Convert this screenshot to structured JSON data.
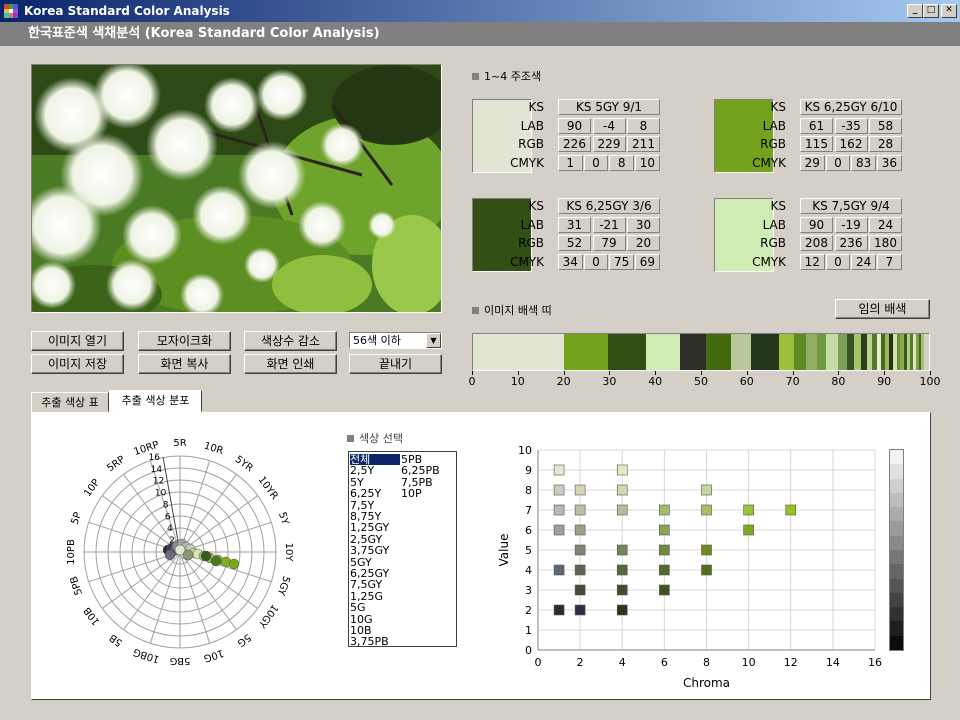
{
  "window": {
    "title": "Korea Standard Color Analysis",
    "subtitle": "한국표준색 색채분석 (Korea Standard Color Analysis)"
  },
  "buttons": {
    "open": "이미지 열기",
    "mosaic": "모자이크화",
    "reduce": "색상수 감소",
    "save": "이미지 저장",
    "copy": "화면 복사",
    "print": "화면 인쇄",
    "exit": "끝내기",
    "random": "임의 배색"
  },
  "dropdown": {
    "value": "56색 이하"
  },
  "main_colors": {
    "heading": "1~4 주조색",
    "labels": [
      "KS",
      "LAB",
      "RGB",
      "CMYK"
    ],
    "items": [
      {
        "ks": "KS 5GY 9/1",
        "lab": [
          "90",
          "-4",
          "8"
        ],
        "rgb": [
          "226",
          "229",
          "211"
        ],
        "cmyk": [
          "1",
          "0",
          "8",
          "10"
        ],
        "color": "#e2e5d3"
      },
      {
        "ks": "KS 6,25GY 6/10",
        "lab": [
          "61",
          "-35",
          "58"
        ],
        "rgb": [
          "115",
          "162",
          "28"
        ],
        "cmyk": [
          "29",
          "0",
          "83",
          "36"
        ],
        "color": "#73a21c"
      },
      {
        "ks": "KS 6,25GY 3/6",
        "lab": [
          "31",
          "-21",
          "30"
        ],
        "rgb": [
          "52",
          "79",
          "20"
        ],
        "cmyk": [
          "34",
          "0",
          "75",
          "69"
        ],
        "color": "#344f14"
      },
      {
        "ks": "KS 7,5GY 9/4",
        "lab": [
          "90",
          "-19",
          "24"
        ],
        "rgb": [
          "208",
          "236",
          "180"
        ],
        "cmyk": [
          "12",
          "0",
          "24",
          "7"
        ],
        "color": "#d0ecb4"
      }
    ]
  },
  "palette": {
    "heading": "이미지 배색 띠",
    "ticks": [
      "0",
      "10",
      "20",
      "30",
      "40",
      "50",
      "60",
      "70",
      "80",
      "90",
      "100"
    ],
    "segments": [
      {
        "color": "#e2e5d3",
        "w": 20
      },
      {
        "color": "#73a21c",
        "w": 9.5
      },
      {
        "color": "#344f14",
        "w": 8.5
      },
      {
        "color": "#d0ecb4",
        "w": 7.5
      },
      {
        "color": "#2d2f26",
        "w": 5.5
      },
      {
        "color": "#436a0e",
        "w": 5.5
      },
      {
        "color": "#b8c89c",
        "w": 4.5
      },
      {
        "color": "#22371c",
        "w": 6
      },
      {
        "color": "#9cc03a",
        "w": 3.5
      },
      {
        "color": "#5e8a25",
        "w": 2.5
      },
      {
        "color": "#8fae68",
        "w": 2.5
      },
      {
        "color": "#6e9a46",
        "w": 2
      },
      {
        "color": "#c6dca4",
        "w": 2.5
      },
      {
        "color": "#7f9e5a",
        "w": 2
      },
      {
        "color": "#3a5224",
        "w": 1.5
      },
      {
        "color": "#a5c46e",
        "w": 1.5
      },
      {
        "color": "#2e3e1c",
        "w": 1.3
      },
      {
        "color": "#bcd68e",
        "w": 1.2
      },
      {
        "color": "#557c2e",
        "w": 1
      },
      {
        "color": "#e8f0d0",
        "w": 1
      },
      {
        "color": "#4a6a20",
        "w": 0.9
      },
      {
        "color": "#9ab860",
        "w": 0.9
      },
      {
        "color": "#263218",
        "w": 0.8
      },
      {
        "color": "#cfe0a8",
        "w": 0.8
      },
      {
        "color": "#6c8c3c",
        "w": 0.8
      },
      {
        "color": "#88aa4c",
        "w": 0.8
      },
      {
        "color": "#3c5a1a",
        "w": 0.7
      },
      {
        "color": "#b4cc84",
        "w": 0.7
      },
      {
        "color": "#5a7830",
        "w": 0.7
      },
      {
        "color": "#dce8c0",
        "w": 0.6
      },
      {
        "color": "#7aa03a",
        "w": 0.6
      },
      {
        "color": "#486428",
        "w": 0.5
      },
      {
        "color": "#a8c078",
        "w": 0.5
      }
    ]
  },
  "tabs": [
    "추출 색상 표",
    "추출 색상 분포"
  ],
  "hue_select": {
    "heading": "색상 선택",
    "items": [
      "전체",
      "2,5Y",
      "5Y",
      "6,25Y",
      "7,5Y",
      "8,75Y",
      "1,25GY",
      "2,5GY",
      "3,75GY",
      "5GY",
      "6,25GY",
      "7,5GY",
      "1,25G",
      "5G",
      "10G",
      "10B",
      "3,75PB",
      "5PB",
      "6,25PB",
      "7,5PB",
      "10P"
    ]
  },
  "polar_chart": {
    "hue_labels": [
      "5R",
      "10R",
      "5YR",
      "10YR",
      "5Y",
      "10Y",
      "5GY",
      "10GY",
      "5G",
      "10G",
      "5BG",
      "10BG",
      "5B",
      "10B",
      "5PB",
      "10PB",
      "5P",
      "10P",
      "5RP",
      "10RP"
    ],
    "rings": [
      "2",
      "4",
      "6",
      "8",
      "10",
      "12",
      "14",
      "16"
    ]
  },
  "chart_data": {
    "type": "scatter",
    "xlabel": "Chroma",
    "ylabel": "Value",
    "xlim": [
      0,
      16
    ],
    "ylim": [
      0,
      10
    ],
    "xticks": [
      "0",
      "2",
      "4",
      "6",
      "8",
      "10",
      "12",
      "14",
      "16"
    ],
    "yticks": [
      "0",
      "1",
      "2",
      "3",
      "4",
      "5",
      "6",
      "7",
      "8",
      "9",
      "10"
    ],
    "points": [
      {
        "x": 1,
        "y": 9,
        "c": "#e6e8d6"
      },
      {
        "x": 4,
        "y": 9,
        "c": "#e0ecc8"
      },
      {
        "x": 1,
        "y": 8,
        "c": "#c8cfc0"
      },
      {
        "x": 2,
        "y": 8,
        "c": "#d8d4b8"
      },
      {
        "x": 4,
        "y": 8,
        "c": "#cdd8b4"
      },
      {
        "x": 8,
        "y": 8,
        "c": "#c2d896"
      },
      {
        "x": 1,
        "y": 7,
        "c": "#b4bcae"
      },
      {
        "x": 2,
        "y": 7,
        "c": "#b8c0a6"
      },
      {
        "x": 4,
        "y": 7,
        "c": "#b0bf98"
      },
      {
        "x": 6,
        "y": 7,
        "c": "#a2bb70"
      },
      {
        "x": 8,
        "y": 7,
        "c": "#a6c260"
      },
      {
        "x": 10,
        "y": 7,
        "c": "#9cc23a"
      },
      {
        "x": 12,
        "y": 7,
        "c": "#96c220"
      },
      {
        "x": 1,
        "y": 6,
        "c": "#9aa496"
      },
      {
        "x": 2,
        "y": 6,
        "c": "#97a28a"
      },
      {
        "x": 6,
        "y": 6,
        "c": "#88a456"
      },
      {
        "x": 10,
        "y": 6,
        "c": "#7eab24"
      },
      {
        "x": 2,
        "y": 5,
        "c": "#7c8670"
      },
      {
        "x": 4,
        "y": 5,
        "c": "#738558"
      },
      {
        "x": 6,
        "y": 5,
        "c": "#6e8a40"
      },
      {
        "x": 8,
        "y": 5,
        "c": "#6a8e24"
      },
      {
        "x": 1,
        "y": 4,
        "c": "#5c6670"
      },
      {
        "x": 2,
        "y": 4,
        "c": "#5c6650"
      },
      {
        "x": 4,
        "y": 4,
        "c": "#566840"
      },
      {
        "x": 6,
        "y": 4,
        "c": "#506c2a"
      },
      {
        "x": 8,
        "y": 4,
        "c": "#4e7018"
      },
      {
        "x": 2,
        "y": 3,
        "c": "#464c3c"
      },
      {
        "x": 4,
        "y": 3,
        "c": "#40502e"
      },
      {
        "x": 6,
        "y": 3,
        "c": "#3c541e"
      },
      {
        "x": 1,
        "y": 2,
        "c": "#2c2c34"
      },
      {
        "x": 2,
        "y": 2,
        "c": "#2c3040"
      },
      {
        "x": 4,
        "y": 2,
        "c": "#2c3422"
      }
    ]
  },
  "grayscale_bar": [
    "#f2f2f2",
    "#e0e0e0",
    "#cfcfcf",
    "#bdbdbd",
    "#acacac",
    "#9a9a9a",
    "#898989",
    "#777777",
    "#666666",
    "#545454",
    "#434343",
    "#313131",
    "#1e1e1e",
    "#0c0c0c"
  ]
}
